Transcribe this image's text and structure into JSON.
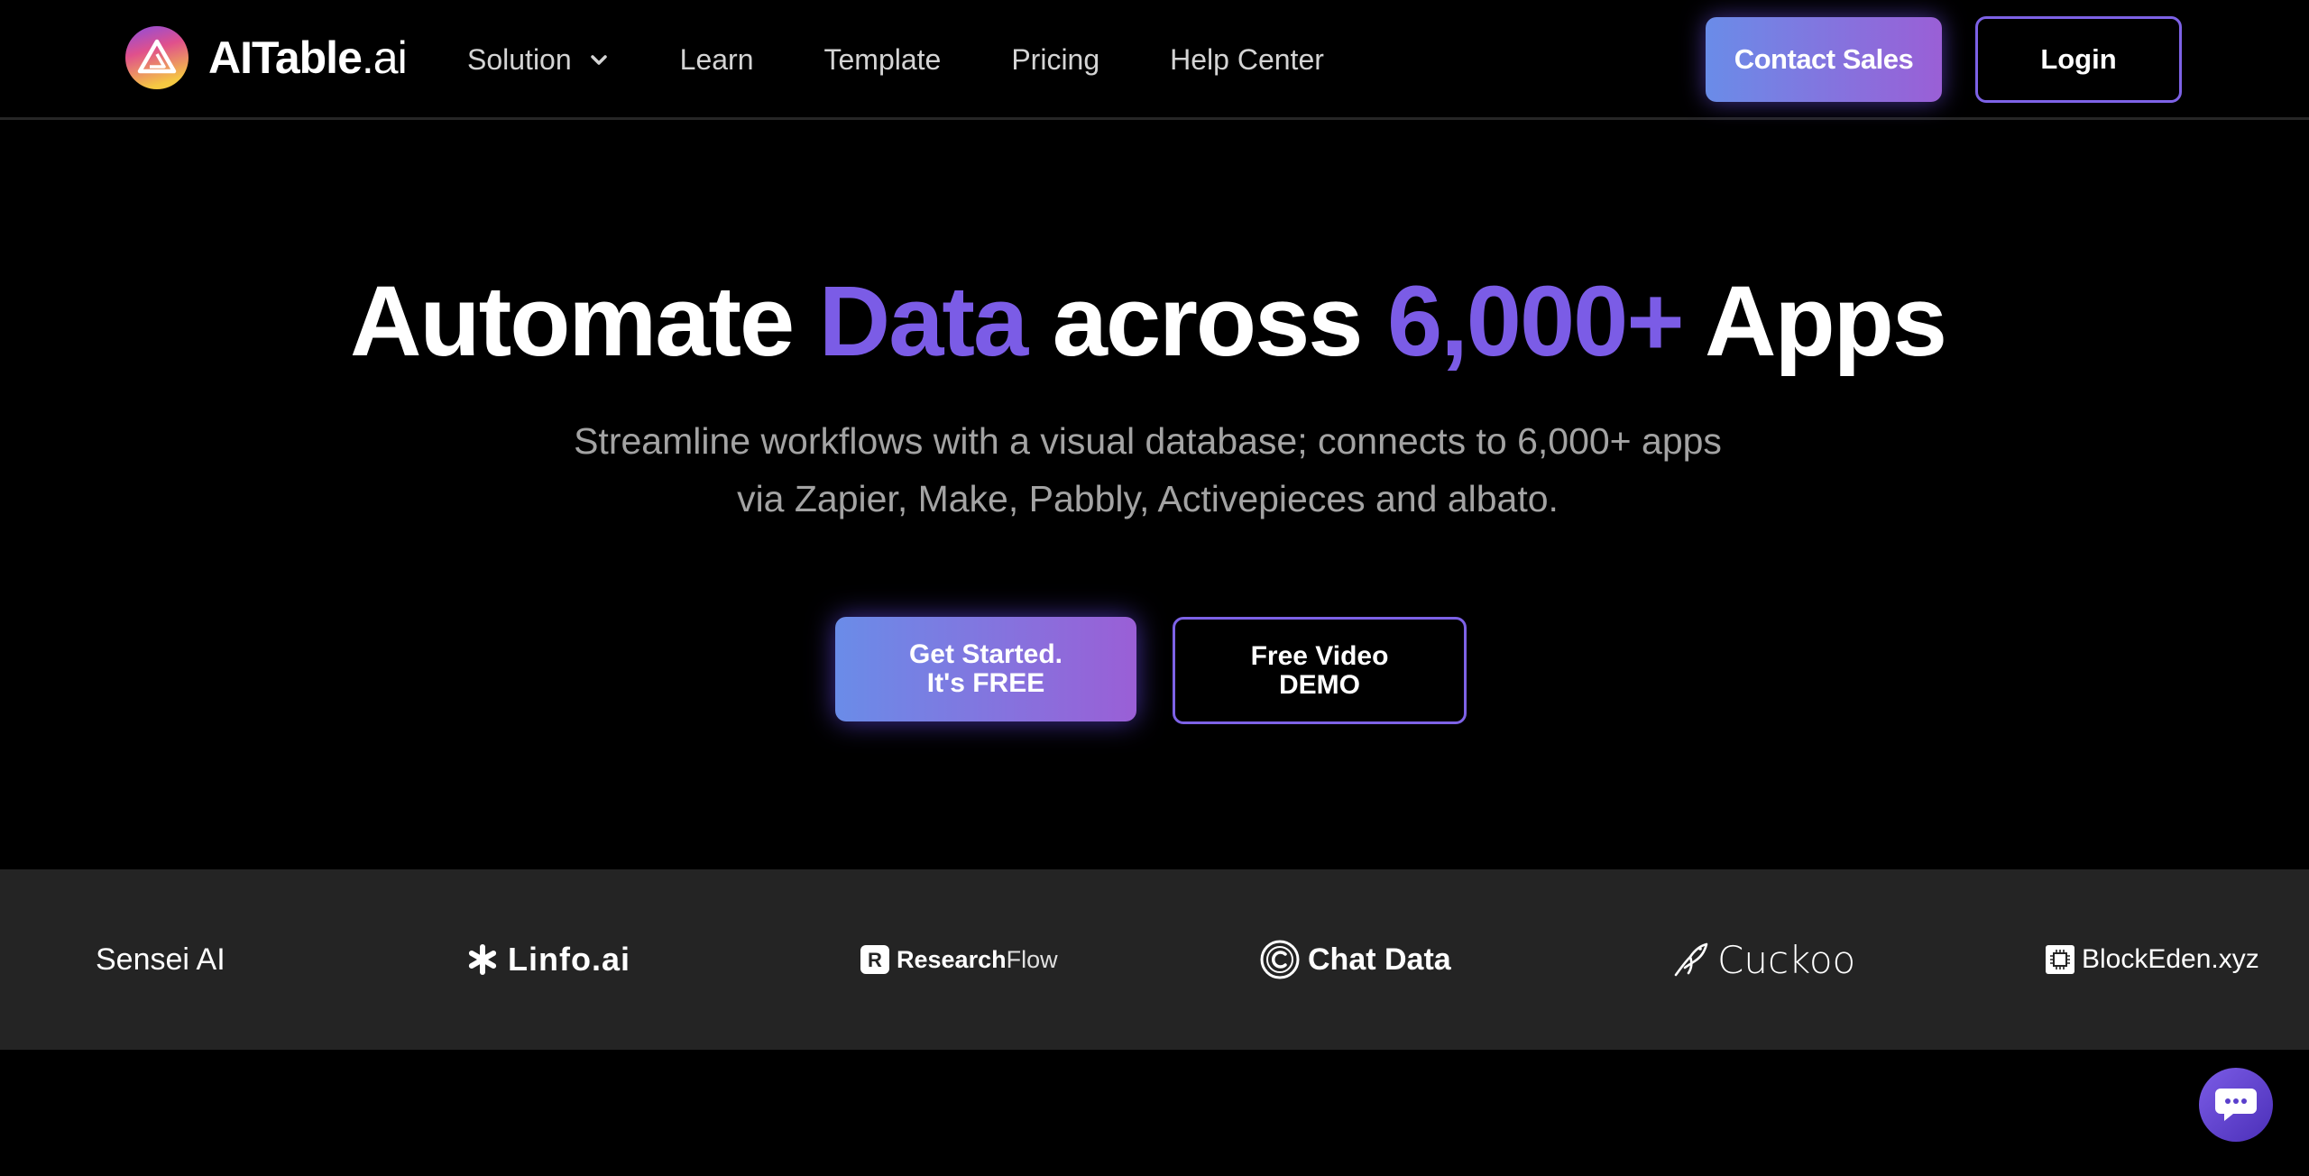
{
  "header": {
    "logo": {
      "text_main": "AITable",
      "text_suffix": ".ai",
      "icon": "aitable-logo-icon"
    },
    "nav": [
      {
        "label": "Solution",
        "has_dropdown": true,
        "icon": "chevron-down-icon"
      },
      {
        "label": "Learn"
      },
      {
        "label": "Template"
      },
      {
        "label": "Pricing"
      },
      {
        "label": "Help Center"
      }
    ],
    "contact_sales_label": "Contact Sales",
    "login_label": "Login"
  },
  "hero": {
    "title_part1": "Automate ",
    "title_accent1": "Data",
    "title_part2": " across ",
    "title_accent2": "6,000+",
    "title_part3": " Apps",
    "subtitle_line1": "Streamline workflows with a visual database; connects to 6,000+ apps",
    "subtitle_line2": "via Zapier, Make, Pabbly, Activepieces and albato.",
    "cta_primary_line1": "Get Started.",
    "cta_primary_line2": "It's FREE",
    "cta_secondary_line1": "Free Video",
    "cta_secondary_line2": "DEMO"
  },
  "customer_logos": [
    {
      "name": "Sensei AI"
    },
    {
      "name": "Linfo.ai",
      "icon": "asterisk-icon"
    },
    {
      "name_bold": "Research",
      "name_light": "Flow",
      "icon": "researchflow-r-icon"
    },
    {
      "name": "Chat Data",
      "icon": "copyright-c-icon"
    },
    {
      "name": "Cuckoo",
      "icon": "bird-icon"
    },
    {
      "name": "BlockEden.xyz",
      "icon": "chip-icon"
    }
  ],
  "chat_widget": {
    "icon": "chat-bubble-icon"
  },
  "colors": {
    "background": "#000000",
    "accent": "#7b5ce6",
    "gradient_start": "#6a8ce8",
    "gradient_end": "#9a5fd6",
    "strip_bg": "#242424",
    "subtitle": "#a3a3a3"
  }
}
